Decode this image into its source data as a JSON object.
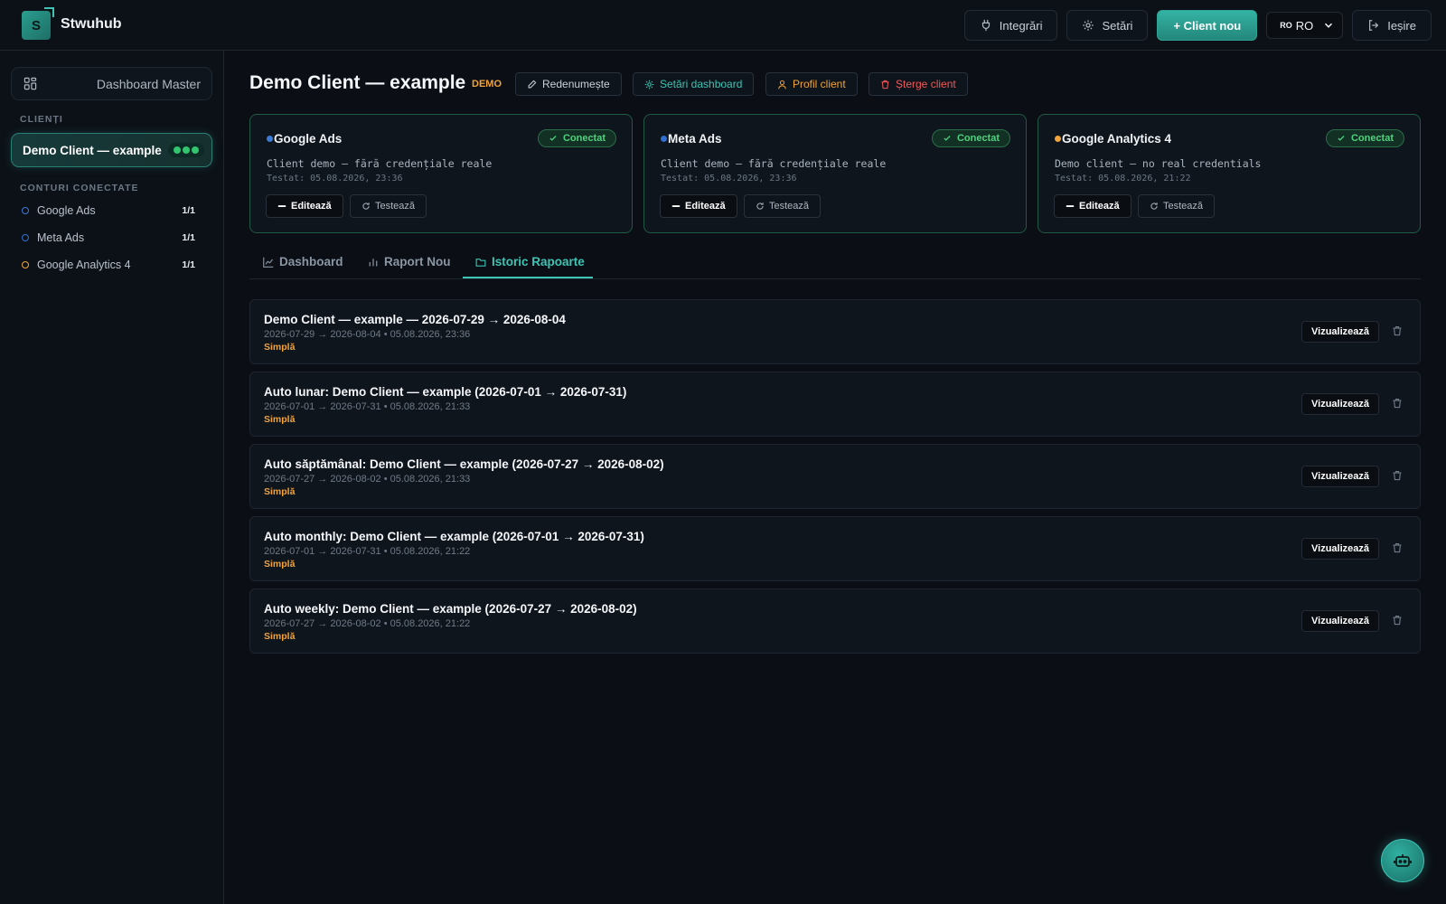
{
  "app": {
    "logo_letter": "S",
    "name": "Stwuhub"
  },
  "topbar": {
    "integrations": "Integrări",
    "settings": "Setări",
    "new_client": "+ Client nou",
    "lang_flag": "RO",
    "lang_value": "RO",
    "logout": "Ieșire"
  },
  "sidebar": {
    "master": "Dashboard Master",
    "clients_heading": "CLIENȚI",
    "client_name": "Demo Client — example",
    "accounts_heading": "CONTURI CONECTATE",
    "accounts": [
      {
        "name": "Google Ads",
        "count": "1/1",
        "color": "#3d7bd9"
      },
      {
        "name": "Meta Ads",
        "count": "1/1",
        "color": "#2f6fd0"
      },
      {
        "name": "Google Analytics 4",
        "count": "1/1",
        "color": "#f0a33a"
      }
    ]
  },
  "header": {
    "title": "Demo Client — example",
    "badge": "DEMO",
    "rename": "Redenumește",
    "dashboard_settings": "Setări dashboard",
    "client_profile": "Profil client",
    "delete_client": "Șterge client"
  },
  "cards": [
    {
      "title": "Google Ads",
      "status": "Conectat",
      "desc": "Client demo – fără credențiale reale",
      "tested": "Testat: 05.08.2026, 23:36",
      "dot": "#3d7bd9"
    },
    {
      "title": "Meta Ads",
      "status": "Conectat",
      "desc": "Client demo – fără credențiale reale",
      "tested": "Testat: 05.08.2026, 23:36",
      "dot": "#2f6fd0"
    },
    {
      "title": "Google Analytics 4",
      "status": "Conectat",
      "desc": "Demo client – no real credentials",
      "tested": "Testat: 05.08.2026, 21:22",
      "dot": "#f0a33a"
    }
  ],
  "card_actions": {
    "edit": "Editează",
    "test": "Testează"
  },
  "tabs": {
    "dashboard": "Dashboard",
    "new_report": "Raport Nou",
    "history": "Istoric Rapoarte"
  },
  "reports": [
    {
      "title": "Demo Client — example — 2026-07-29 → 2026-08-04",
      "meta": "2026-07-29 → 2026-08-04 • 05.08.2026, 23:36",
      "type": "Simplă"
    },
    {
      "title": "Auto lunar: Demo Client — example (2026-07-01 → 2026-07-31)",
      "meta": "2026-07-01 → 2026-07-31 • 05.08.2026, 21:33",
      "type": "Simplă"
    },
    {
      "title": "Auto săptămânal: Demo Client — example (2026-07-27 → 2026-08-02)",
      "meta": "2026-07-27 → 2026-08-02 • 05.08.2026, 21:33",
      "type": "Simplă"
    },
    {
      "title": "Auto monthly: Demo Client — example (2026-07-01 → 2026-07-31)",
      "meta": "2026-07-01 → 2026-07-31 • 05.08.2026, 21:22",
      "type": "Simplă"
    },
    {
      "title": "Auto weekly: Demo Client — example (2026-07-27 → 2026-08-02)",
      "meta": "2026-07-27 → 2026-08-02 • 05.08.2026, 21:22",
      "type": "Simplă"
    }
  ],
  "report_actions": {
    "view": "Vizualizează"
  },
  "colors": {
    "accent": "#3cc4b4",
    "connected": "#4cd37e",
    "warning": "#f0a33a",
    "danger": "#f05a5a"
  }
}
